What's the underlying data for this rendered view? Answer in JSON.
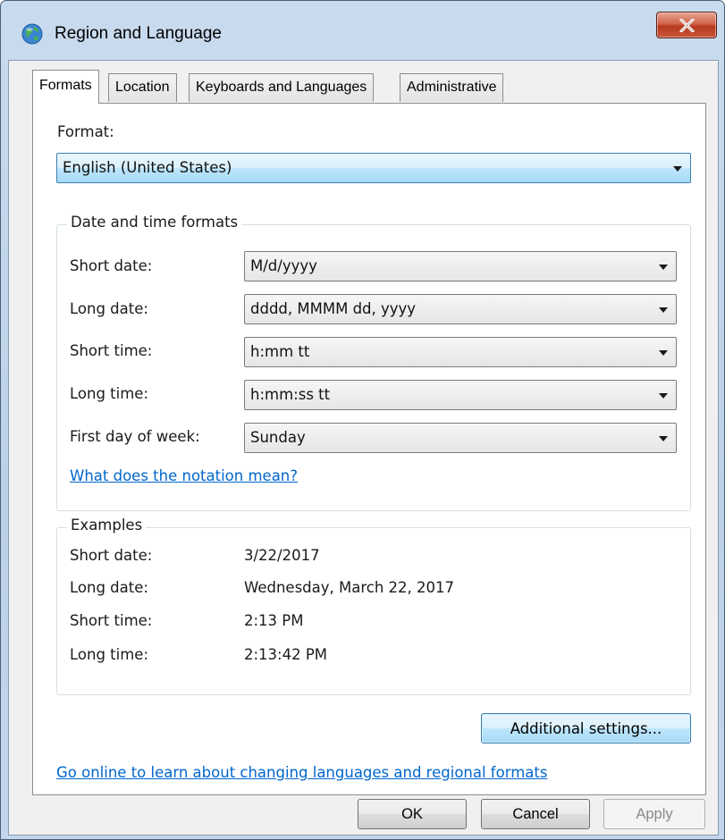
{
  "window": {
    "title": "Region and Language",
    "icons": {
      "app": "globe-icon",
      "close": "close-icon"
    }
  },
  "tabs": [
    {
      "label": "Formats",
      "active": true
    },
    {
      "label": "Location",
      "active": false
    },
    {
      "label": "Keyboards and Languages",
      "active": false
    },
    {
      "label": "Administrative",
      "active": false
    }
  ],
  "format": {
    "label": "Format:",
    "value": "English (United States)"
  },
  "date_time_formats": {
    "title": "Date and time formats",
    "rows": [
      {
        "label": "Short date:",
        "value": "M/d/yyyy"
      },
      {
        "label": "Long date:",
        "value": "dddd, MMMM dd, yyyy"
      },
      {
        "label": "Short time:",
        "value": "h:mm tt"
      },
      {
        "label": "Long time:",
        "value": "h:mm:ss tt"
      },
      {
        "label": "First day of week:",
        "value": "Sunday"
      }
    ],
    "notation_link": "What does the notation mean?"
  },
  "examples": {
    "title": "Examples",
    "rows": [
      {
        "label": "Short date:",
        "value": "3/22/2017"
      },
      {
        "label": "Long date:",
        "value": "Wednesday, March 22, 2017"
      },
      {
        "label": "Short time:",
        "value": "2:13 PM"
      },
      {
        "label": "Long time:",
        "value": "2:13:42 PM"
      }
    ]
  },
  "additional_settings_label": "Additional settings...",
  "online_link": "Go online to learn about changing languages and regional formats",
  "footer": {
    "ok": "OK",
    "cancel": "Cancel",
    "apply": "Apply"
  },
  "colors": {
    "accent": "#3c7fb1",
    "link": "#0066cc",
    "close": "#c8573b"
  }
}
